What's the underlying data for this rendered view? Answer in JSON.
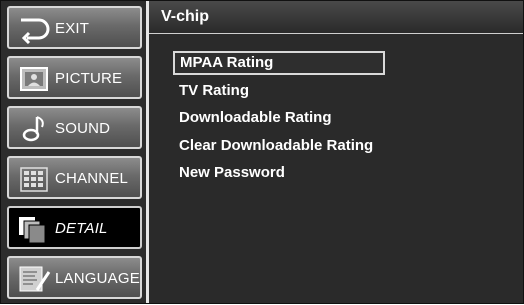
{
  "sidebar": {
    "items": [
      {
        "label": "EXIT",
        "icon": "exit-icon"
      },
      {
        "label": "PICTURE",
        "icon": "picture-icon"
      },
      {
        "label": "SOUND",
        "icon": "sound-icon"
      },
      {
        "label": "CHANNEL",
        "icon": "channel-icon"
      },
      {
        "label": "DETAIL",
        "icon": "detail-icon",
        "active": true
      },
      {
        "label": "LANGUAGE",
        "icon": "language-icon"
      }
    ]
  },
  "header": {
    "title": "V-chip"
  },
  "menu": {
    "items": [
      {
        "label": "MPAA Rating",
        "selected": true
      },
      {
        "label": "TV Rating"
      },
      {
        "label": "Downloadable Rating"
      },
      {
        "label": "Clear Downloadable Rating"
      },
      {
        "label": "New Password"
      }
    ]
  },
  "colors": {
    "background": "#2a2a2a",
    "active_item": "#000000",
    "text": "#ffffff",
    "highlight_border": "#d9d9d9"
  }
}
